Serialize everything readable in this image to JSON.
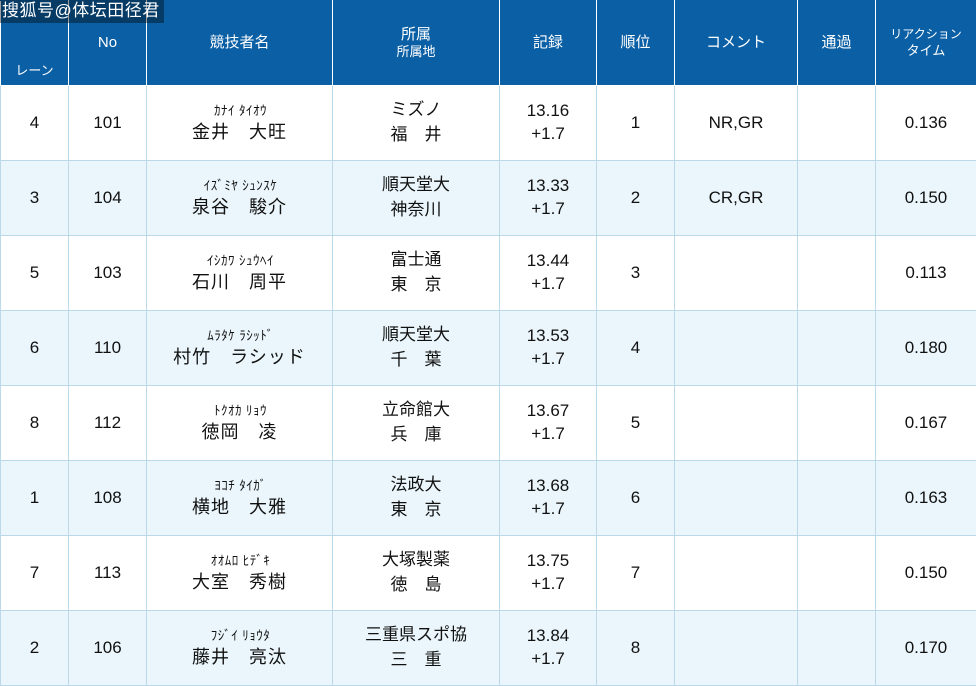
{
  "watermark": {
    "text": "搜狐号@体坛田径君"
  },
  "table": {
    "headers": {
      "lane": "レーン",
      "no": "No",
      "name": "競技者名",
      "affiliation_line1": "所属",
      "affiliation_line2": "所属地",
      "record": "記録",
      "rank": "順位",
      "comment": "コメント",
      "pass": "通過",
      "reaction_line1": "リアクション",
      "reaction_line2": "タイム"
    },
    "rows": [
      {
        "lane": "4",
        "no": "101",
        "name_kana": "ｶﾅｲ ﾀｲｵｳ",
        "name_kanji": "金井　大旺",
        "affil": "ミズノ",
        "affil_area": "福　井",
        "record": "13.16",
        "wind": "+1.7",
        "rank": "1",
        "comment": "NR,GR",
        "pass": "",
        "reaction": "0.136"
      },
      {
        "lane": "3",
        "no": "104",
        "name_kana": "ｲｽﾞﾐﾔ ｼｭﾝｽｹ",
        "name_kanji": "泉谷　駿介",
        "affil": "順天堂大",
        "affil_area": "神奈川",
        "record": "13.33",
        "wind": "+1.7",
        "rank": "2",
        "comment": "CR,GR",
        "pass": "",
        "reaction": "0.150"
      },
      {
        "lane": "5",
        "no": "103",
        "name_kana": "ｲｼｶﾜ ｼｭｳﾍｲ",
        "name_kanji": "石川　周平",
        "affil": "富士通",
        "affil_area": "東　京",
        "record": "13.44",
        "wind": "+1.7",
        "rank": "3",
        "comment": "",
        "pass": "",
        "reaction": "0.113"
      },
      {
        "lane": "6",
        "no": "110",
        "name_kana": "ﾑﾗﾀｹ ﾗｼｯﾄﾞ",
        "name_kanji": "村竹　ラシッド",
        "affil": "順天堂大",
        "affil_area": "千　葉",
        "record": "13.53",
        "wind": "+1.7",
        "rank": "4",
        "comment": "",
        "pass": "",
        "reaction": "0.180"
      },
      {
        "lane": "8",
        "no": "112",
        "name_kana": "ﾄｸｵｶ ﾘｮｳ",
        "name_kanji": "徳岡　凌",
        "affil": "立命館大",
        "affil_area": "兵　庫",
        "record": "13.67",
        "wind": "+1.7",
        "rank": "5",
        "comment": "",
        "pass": "",
        "reaction": "0.167"
      },
      {
        "lane": "1",
        "no": "108",
        "name_kana": "ﾖｺﾁ ﾀｲｶﾞ",
        "name_kanji": "横地　大雅",
        "affil": "法政大",
        "affil_area": "東　京",
        "record": "13.68",
        "wind": "+1.7",
        "rank": "6",
        "comment": "",
        "pass": "",
        "reaction": "0.163"
      },
      {
        "lane": "7",
        "no": "113",
        "name_kana": "ｵｵﾑﾛ ﾋﾃﾞｷ",
        "name_kanji": "大室　秀樹",
        "affil": "大塚製薬",
        "affil_area": "徳　島",
        "record": "13.75",
        "wind": "+1.7",
        "rank": "7",
        "comment": "",
        "pass": "",
        "reaction": "0.150"
      },
      {
        "lane": "2",
        "no": "106",
        "name_kana": "ﾌｼﾞｲ ﾘｮｳﾀ",
        "name_kanji": "藤井　亮汰",
        "affil": "三重県スポ協",
        "affil_area": "三　重",
        "record": "13.84",
        "wind": "+1.7",
        "rank": "8",
        "comment": "",
        "pass": "",
        "reaction": "0.170"
      }
    ]
  },
  "colors": {
    "header_bg": "#0b5fa5",
    "row_alt_bg": "#eaf6fb",
    "border": "#bcd9ea"
  }
}
